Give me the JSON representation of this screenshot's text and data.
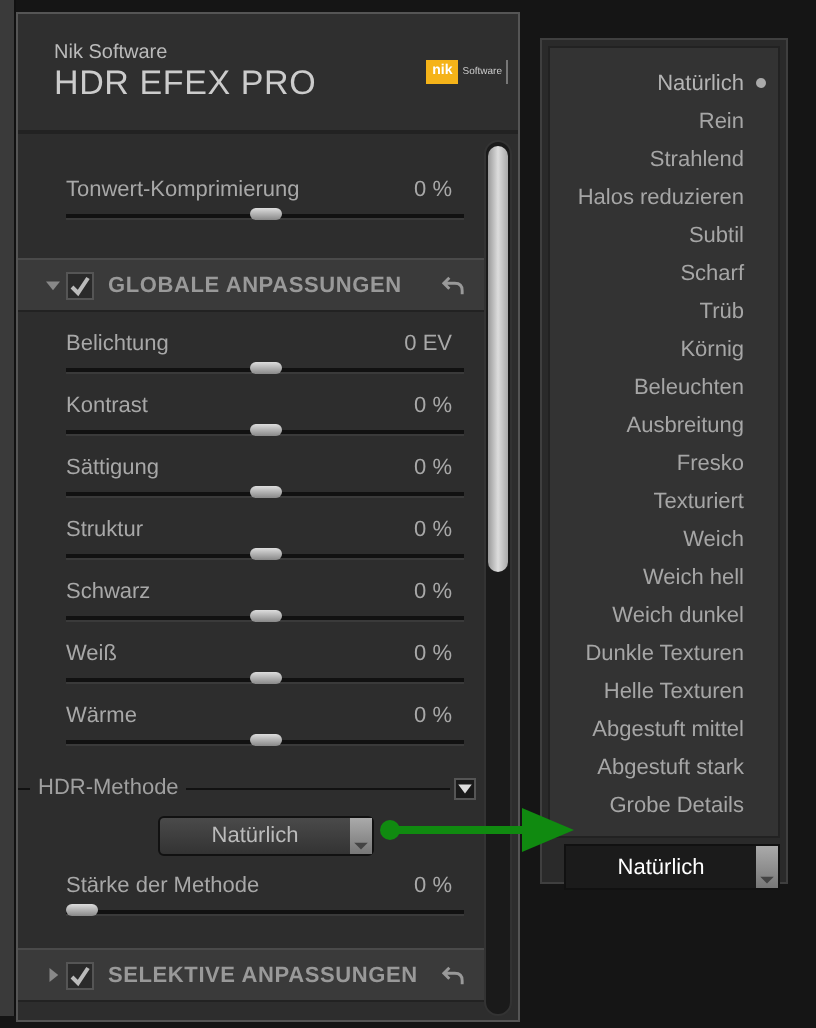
{
  "header": {
    "vendor": "Nik Software",
    "title": "HDR EFEX PRO",
    "logo": {
      "mark": "nik",
      "text": "Software"
    }
  },
  "top_slider": {
    "label": "Tonwert-Komprimierung",
    "value": "0 %",
    "level": 0.5
  },
  "sections": [
    {
      "title": "GLOBALE ANPASSUNGEN",
      "checked": true,
      "expanded": true,
      "sliders": [
        {
          "label": "Belichtung",
          "value": "0 EV",
          "level": 0.5
        },
        {
          "label": "Kontrast",
          "value": "0 %",
          "level": 0.5
        },
        {
          "label": "Sättigung",
          "value": "0 %",
          "level": 0.5
        },
        {
          "label": "Struktur",
          "value": "0 %",
          "level": 0.5
        },
        {
          "label": "Schwarz",
          "value": "0 %",
          "level": 0.5
        },
        {
          "label": "Weiß",
          "value": "0 %",
          "level": 0.5
        },
        {
          "label": "Wärme",
          "value": "0 %",
          "level": 0.5
        }
      ]
    },
    {
      "title": "SELEKTIVE ANPASSUNGEN",
      "checked": true,
      "expanded": false
    }
  ],
  "hdr_method": {
    "label": "HDR-Methode",
    "select_value": "Natürlich",
    "strength": {
      "label": "Stärke der Methode",
      "value": "0 %",
      "level": 0.02
    }
  },
  "menu": {
    "items": [
      {
        "label": "Natürlich",
        "selected": true
      },
      {
        "label": "Rein",
        "selected": false
      },
      {
        "label": "Strahlend",
        "selected": false
      },
      {
        "label": "Halos reduzieren",
        "selected": false
      },
      {
        "label": "Subtil",
        "selected": false
      },
      {
        "label": "Scharf",
        "selected": false
      },
      {
        "label": "Trüb",
        "selected": false
      },
      {
        "label": "Körnig",
        "selected": false
      },
      {
        "label": "Beleuchten",
        "selected": false
      },
      {
        "label": "Ausbreitung",
        "selected": false
      },
      {
        "label": "Fresko",
        "selected": false
      },
      {
        "label": "Texturiert",
        "selected": false
      },
      {
        "label": "Weich",
        "selected": false
      },
      {
        "label": "Weich hell",
        "selected": false
      },
      {
        "label": "Weich dunkel",
        "selected": false
      },
      {
        "label": "Dunkle Texturen",
        "selected": false
      },
      {
        "label": "Helle Texturen",
        "selected": false
      },
      {
        "label": "Abgestuft mittel",
        "selected": false
      },
      {
        "label": "Abgestuft stark",
        "selected": false
      },
      {
        "label": "Grobe Details",
        "selected": false
      }
    ],
    "select_value": "Natürlich"
  }
}
